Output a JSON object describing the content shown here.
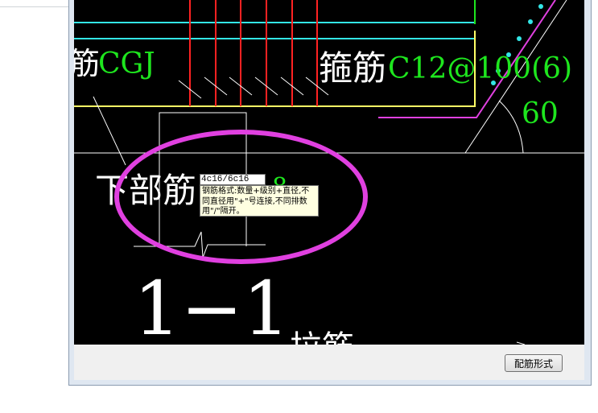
{
  "colors": {
    "canvas_bg": "#000000",
    "cad_white": "#ffffff",
    "cad_green": "#1ee61e",
    "cad_yellow": "#ffff66",
    "cad_red": "#ff2222",
    "cad_cyan": "#33e6e6",
    "cad_magenta": "#e040e0",
    "tooltip_bg": "#ffffe1"
  },
  "drawing": {
    "label_cgj_prefix": "筋",
    "label_cgj_code": "CGJ",
    "label_stirrup": "箍筋",
    "label_stirrup_spec": "C12@100(6)",
    "label_angle": "60",
    "label_bottom_bar": "下部筋",
    "label_bottom_bar_suffix": "8",
    "label_section": "1−1",
    "label_partial_bottom": "拉筋"
  },
  "editor": {
    "input_value": "4c16/6c16",
    "tooltip_text": "钢筋格式:数量+级别+直径,不同直径用\"+\"号连接,不同排数用\"/\"隔开。"
  },
  "statusbar": {
    "pattern_button_label": "配筋形式"
  }
}
